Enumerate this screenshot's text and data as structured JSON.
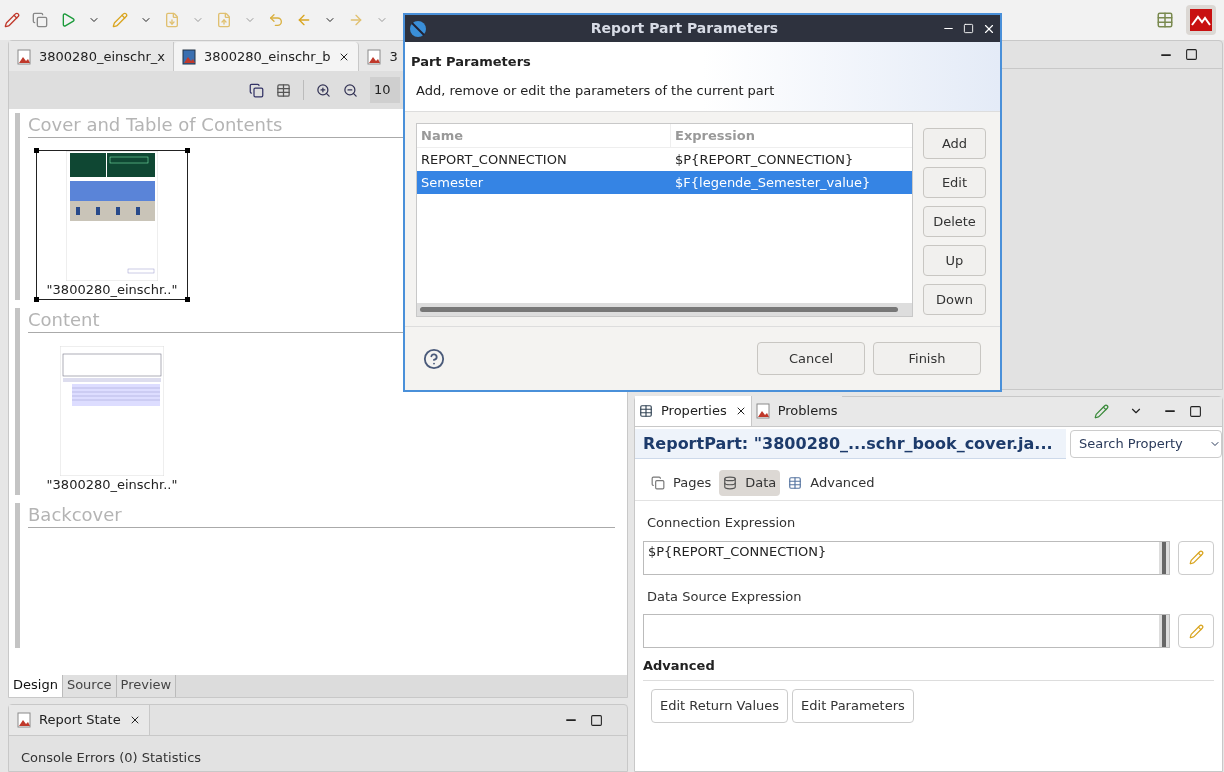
{
  "zoom_field": {
    "value": "10"
  },
  "editor_tabs": [
    {
      "label": "3800280_einschr_x",
      "selected": false
    },
    {
      "label": "3800280_einschr_b",
      "selected": true
    },
    {
      "label": "3",
      "selected": false
    }
  ],
  "sections": [
    {
      "title": "Cover and Table of Contents",
      "parts": [
        {
          "label": "\"3800280_einschr..\"",
          "selected": true,
          "kind": "cover"
        }
      ]
    },
    {
      "title": "Content",
      "parts": [
        {
          "label": "\"3800280_einschr..\"",
          "selected": false,
          "kind": "table"
        }
      ]
    },
    {
      "title": "Backcover"
    }
  ],
  "editor_mode_tabs": [
    {
      "label": "Design",
      "selected": true
    },
    {
      "label": "Source",
      "selected": false
    },
    {
      "label": "Preview",
      "selected": false
    }
  ],
  "report_state": {
    "title": "Report State",
    "tabs": [
      "Console",
      "Errors (0)",
      "Statistics"
    ]
  },
  "properties": {
    "tabs": [
      {
        "label": "Properties",
        "selected": true
      },
      {
        "label": "Problems",
        "selected": false
      }
    ],
    "title": "ReportPart: \"3800280_...schr_book_cover.ja...",
    "search": {
      "placeholder": "Search Property"
    },
    "sections": [
      {
        "label": "Pages",
        "selected": false,
        "kind": "pages"
      },
      {
        "label": "Data",
        "selected": true,
        "kind": "data"
      },
      {
        "label": "Advanced",
        "selected": false,
        "kind": "advanced"
      }
    ],
    "fields": [
      {
        "label": "Connection Expression",
        "value": "$P{REPORT_CONNECTION}"
      },
      {
        "label": "Data Source Expression"
      }
    ],
    "advanced": {
      "heading": "Advanced",
      "buttons": [
        "Edit Return Values",
        "Edit Parameters"
      ]
    }
  },
  "dialog": {
    "title": "Report Part Parameters",
    "heading": "Part Parameters",
    "description": "Add, remove or edit the parameters of the current part",
    "columns": [
      "Name",
      "Expression"
    ],
    "rows": [
      {
        "name": "REPORT_CONNECTION",
        "expression": "$P{REPORT_CONNECTION}",
        "selected": false
      },
      {
        "name": "Semester",
        "expression": "$F{legende_Semester_value}",
        "selected": true
      }
    ],
    "side_buttons": [
      "Add",
      "Edit",
      "Delete",
      "Up",
      "Down"
    ],
    "footer_buttons": [
      "Cancel",
      "Finish"
    ]
  }
}
